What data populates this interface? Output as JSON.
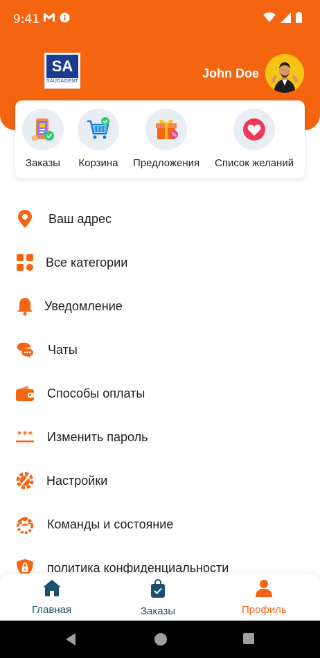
{
  "status_bar": {
    "time": "9:41",
    "left_icons": [
      "gmail-icon",
      "info-icon"
    ],
    "right_icons": [
      "wifi-icon",
      "signal-icon",
      "battery-icon"
    ]
  },
  "header": {
    "logo_text": "SA",
    "logo_subtext": "SAUDAGENT",
    "user_name": "John Doe",
    "accent_color": "#f5640f"
  },
  "quick_actions": [
    {
      "label": "Заказы",
      "icon": "orders-phone-icon"
    },
    {
      "label": "Корзина",
      "icon": "cart-icon"
    },
    {
      "label": "Предложения",
      "icon": "gift-offer-icon"
    },
    {
      "label": "Список желаний",
      "icon": "heart-icon"
    }
  ],
  "menu": [
    {
      "label": "Ваш адрес",
      "icon": "location-pin-icon"
    },
    {
      "label": "Все категории",
      "icon": "grid-icon"
    },
    {
      "label": "Уведомление",
      "icon": "bell-icon"
    },
    {
      "label": "Чаты",
      "icon": "chat-icon"
    },
    {
      "label": "Способы оплаты",
      "icon": "wallet-icon"
    },
    {
      "label": "Изменить пароль",
      "icon": "password-icon"
    },
    {
      "label": "Настройки",
      "icon": "settings-wrench-icon"
    },
    {
      "label": "Команды и состояние",
      "icon": "team-gear-icon"
    },
    {
      "label": "политика конфиденциальности",
      "icon": "shield-lock-icon"
    }
  ],
  "bottom_nav": [
    {
      "label": "Главная",
      "icon": "home-icon",
      "active": false
    },
    {
      "label": "Заказы",
      "icon": "shopping-bag-icon",
      "active": false
    },
    {
      "label": "Профиль",
      "icon": "profile-icon",
      "active": true
    }
  ],
  "colors": {
    "primary": "#f5640f",
    "nav_inactive": "#1d4f6e",
    "nav_active": "#f5640f"
  }
}
